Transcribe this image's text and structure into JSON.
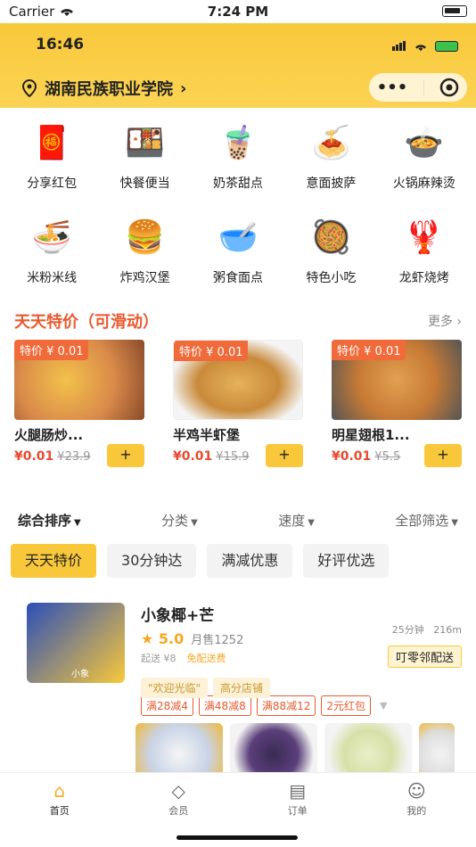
{
  "ios_status": {
    "carrier": "Carrier",
    "time": "7:24 PM"
  },
  "header": {
    "time": "16:46",
    "location": "湖南民族职业学院"
  },
  "categories": [
    {
      "label": "分享红包",
      "icon": "🧧"
    },
    {
      "label": "快餐便当",
      "icon": "🍱"
    },
    {
      "label": "奶茶甜点",
      "icon": "🧋"
    },
    {
      "label": "意面披萨",
      "icon": "🍝"
    },
    {
      "label": "火锅麻辣烫",
      "icon": "🍲"
    },
    {
      "label": "米粉米线",
      "icon": "🍜"
    },
    {
      "label": "炸鸡汉堡",
      "icon": "🍔"
    },
    {
      "label": "粥食面点",
      "icon": "🥣"
    },
    {
      "label": "特色小吃",
      "icon": "🥘"
    },
    {
      "label": "龙虾烧烤",
      "icon": "🦞"
    }
  ],
  "deals": {
    "title": "天天特价（可滑动）",
    "more": "更多",
    "items": [
      {
        "tag": "特价 ¥ 0.01",
        "name": "火腿肠炒...",
        "price": "¥0.01",
        "old_price": "¥23.9",
        "add": "+",
        "color": "#d98a4a"
      },
      {
        "tag": "特价 ¥ 0.01",
        "name": "半鸡半虾堡",
        "price": "¥0.01",
        "old_price": "¥15.9",
        "add": "+",
        "color": "#e6b25a"
      },
      {
        "tag": "特价 ¥ 0.01",
        "name": "明星翅根1...",
        "price": "¥0.01",
        "old_price": "¥5.5",
        "add": "+",
        "color": "#c77a35"
      }
    ]
  },
  "sorts": [
    {
      "label": "综合排序"
    },
    {
      "label": "分类"
    },
    {
      "label": "速度"
    },
    {
      "label": "全部筛选"
    }
  ],
  "chips": [
    "天天特价",
    "30分钟达",
    "满减优惠",
    "好评优选"
  ],
  "shop": {
    "name": "小象椰+芒",
    "score": "5.0",
    "sales": "月售1252",
    "min_order": "起送 ¥8",
    "free_delivery": "免配送费",
    "time": "25分钟",
    "distance": "216m",
    "delivery": "叮零邻配送",
    "tags": [
      "\"欢迎光临\"",
      "高分店铺"
    ],
    "promos": [
      "满28减4",
      "满48减8",
      "满88减12",
      "2元红包"
    ],
    "logo_text": "小象"
  },
  "tabbar": [
    {
      "label": "首页",
      "icon": "⌂"
    },
    {
      "label": "会员",
      "icon": "◇"
    },
    {
      "label": "订单",
      "icon": "▤"
    },
    {
      "label": "我的",
      "icon": "☺"
    }
  ]
}
